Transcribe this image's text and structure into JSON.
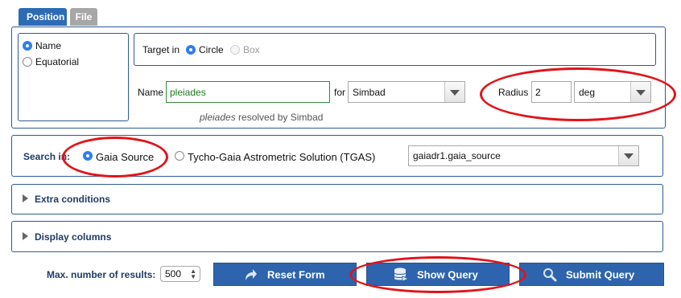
{
  "tabs": {
    "position": "Position",
    "file": "File"
  },
  "coord_system": {
    "name": "Name",
    "equatorial": "Equatorial"
  },
  "target": {
    "label": "Target in",
    "circle": "Circle",
    "box": "Box",
    "name_label": "Name",
    "name_value": "pleiades",
    "for_label": "for",
    "resolver": "Simbad",
    "resolved_name": "pleiades",
    "resolved_suffix": " resolved by Simbad",
    "radius_label": "Radius",
    "radius_value": "2",
    "radius_unit": "deg"
  },
  "search": {
    "label": "Search in:",
    "gaia_source": "Gaia Source",
    "tgas": "Tycho-Gaia Astrometric Solution (TGAS)",
    "table": "gaiadr1.gaia_source"
  },
  "sections": {
    "extra_conditions": "Extra conditions",
    "display_columns": "Display columns"
  },
  "results": {
    "label": "Max. number of results:",
    "value": "500"
  },
  "buttons": {
    "reset": "Reset Form",
    "show_query": "Show Query",
    "submit": "Submit Query"
  },
  "colors": {
    "accent": "#2e64ad",
    "highlight": "#e0141a",
    "name_text": "#1e7a1e"
  }
}
